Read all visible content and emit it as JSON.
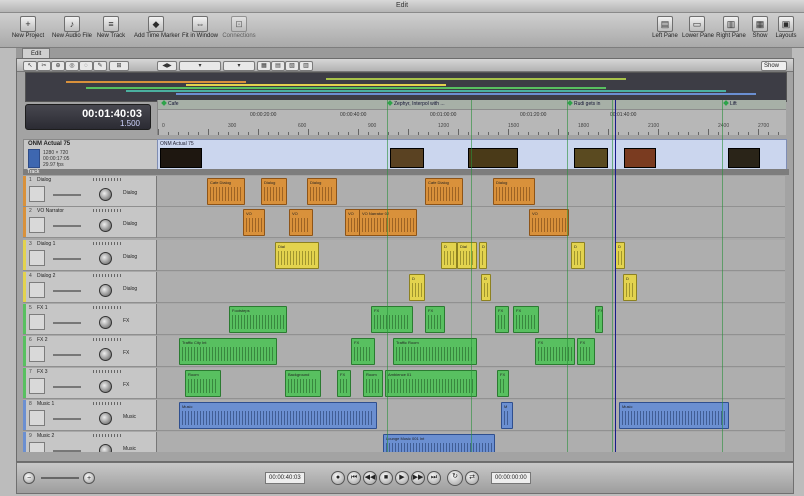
{
  "window": {
    "title": "Edit"
  },
  "toolbar": {
    "left": [
      {
        "label": "New Project",
        "icon": "new-project-icon"
      },
      {
        "label": "New Audio File",
        "icon": "audio-file-icon"
      },
      {
        "label": "New Track",
        "icon": "new-track-icon"
      },
      {
        "label": "Add Time Marker",
        "icon": "marker-icon"
      },
      {
        "label": "Fit in Window",
        "icon": "fit-window-icon"
      },
      {
        "label": "Connections",
        "icon": "connections-icon"
      }
    ],
    "right": [
      {
        "label": "Left Pane",
        "icon": "left-pane-icon"
      },
      {
        "label": "Lower Pane",
        "icon": "lower-pane-icon"
      },
      {
        "label": "Right Pane",
        "icon": "right-pane-icon"
      },
      {
        "label": "Show",
        "icon": "show-icon"
      },
      {
        "label": "Layouts",
        "icon": "layouts-icon"
      }
    ]
  },
  "tabs": [
    {
      "label": "Edit"
    }
  ],
  "subtoolbar": {
    "show_value": "Show"
  },
  "timecode": {
    "main": "00:01:40:03",
    "sub": "1.500"
  },
  "ruler": {
    "markers": [
      {
        "label": "Cafe"
      },
      {
        "label": "Zephyr, Interpol with ..."
      },
      {
        "label": "Rudi gets in"
      },
      {
        "label": "Lift"
      }
    ],
    "timecodes": [
      "00:00:20:00",
      "00:00:40:00",
      "00:01:00:00",
      "00:01:20:00",
      "00:01:40:00"
    ],
    "frames": [
      "0",
      "300",
      "600",
      "900",
      "1200",
      "1500",
      "1800",
      "2100",
      "2400",
      "2700",
      "3000"
    ]
  },
  "film": {
    "name": "ONM Actual 75",
    "meta": [
      "1280 × 720",
      "00:00:17:05",
      "29.97 fps"
    ],
    "strip_label": "ONM Actual 75"
  },
  "tracks_header": "Track",
  "tracks": [
    {
      "num": "1",
      "name": "Dialog",
      "mode": "Dialog",
      "color": "#d9913b"
    },
    {
      "num": "2",
      "name": "VO Narrator",
      "mode": "Dialog",
      "color": "#d9913b"
    },
    {
      "num": "3",
      "name": "Dialog 1",
      "mode": "Dialog",
      "color": "#e3d34e"
    },
    {
      "num": "4",
      "name": "Dialog 2",
      "mode": "Dialog",
      "color": "#e3d34e"
    },
    {
      "num": "5",
      "name": "FX 1",
      "mode": "FX",
      "color": "#58c060"
    },
    {
      "num": "6",
      "name": "FX 2",
      "mode": "FX",
      "color": "#58c060"
    },
    {
      "num": "7",
      "name": "FX 3",
      "mode": "FX",
      "color": "#58c060"
    },
    {
      "num": "8",
      "name": "Music 1",
      "mode": "Music",
      "color": "#6b8fd1"
    },
    {
      "num": "9",
      "name": "Music 2",
      "mode": "Music",
      "color": "#6b8fd1"
    }
  ],
  "clips": [
    [
      {
        "l": "Cafe Dialog",
        "c": "o"
      },
      {
        "l": "Dialog",
        "c": "o"
      },
      {
        "l": "Dialog",
        "c": "o"
      },
      {
        "l": "Cafe Dialog",
        "c": "o"
      },
      {
        "l": "Dialog",
        "c": "o"
      }
    ],
    [
      {
        "l": "VO",
        "c": "o"
      },
      {
        "l": "VO",
        "c": "o"
      },
      {
        "l": "VO",
        "c": "o"
      },
      {
        "l": "VO Narrator 02",
        "c": "o"
      },
      {
        "l": "VO",
        "c": "o"
      }
    ],
    [
      {
        "l": "Dial",
        "c": "y"
      },
      {
        "l": "D",
        "c": "y"
      },
      {
        "l": "Dial",
        "c": "y"
      },
      {
        "l": "D",
        "c": "y"
      },
      {
        "l": "D",
        "c": "y"
      },
      {
        "l": "D",
        "c": "y"
      }
    ],
    [
      {
        "l": "D",
        "c": "y"
      },
      {
        "l": "D",
        "c": "y"
      },
      {
        "l": "D",
        "c": "y"
      }
    ],
    [
      {
        "l": "Footsteps",
        "c": "g"
      },
      {
        "l": "FX",
        "c": "g"
      },
      {
        "l": "FX",
        "c": "g"
      },
      {
        "l": "FX",
        "c": "g"
      },
      {
        "l": "FX",
        "c": "g"
      },
      {
        "l": "FX",
        "c": "g"
      }
    ],
    [
      {
        "l": "Traffic City Int",
        "c": "g"
      },
      {
        "l": "FX",
        "c": "g"
      },
      {
        "l": "Traffic Room",
        "c": "g"
      },
      {
        "l": "FX",
        "c": "g"
      },
      {
        "l": "FX",
        "c": "g"
      }
    ],
    [
      {
        "l": "Room",
        "c": "g"
      },
      {
        "l": "Background",
        "c": "g"
      },
      {
        "l": "FX",
        "c": "g"
      },
      {
        "l": "Room",
        "c": "g"
      },
      {
        "l": "Ambience 01",
        "c": "g"
      },
      {
        "l": "FX",
        "c": "g"
      }
    ],
    [
      {
        "l": "Music",
        "c": "b"
      },
      {
        "l": "M",
        "c": "b"
      },
      {
        "l": "Music",
        "c": "b"
      }
    ],
    [
      {
        "l": "Lounge Music 001 Int",
        "c": "b"
      }
    ]
  ],
  "transport": {
    "left_tc": "00:00:40:03",
    "right_tc": "00:00:00:00",
    "buttons": [
      "record",
      "play-from-start",
      "rewind",
      "stop",
      "play",
      "fast-forward",
      "go-to-end",
      "loop",
      "sync"
    ]
  },
  "colors": {
    "dialog": "#d9913b",
    "dialog_alt": "#e3d34e",
    "fx": "#58c060",
    "music": "#6b8fd1"
  }
}
